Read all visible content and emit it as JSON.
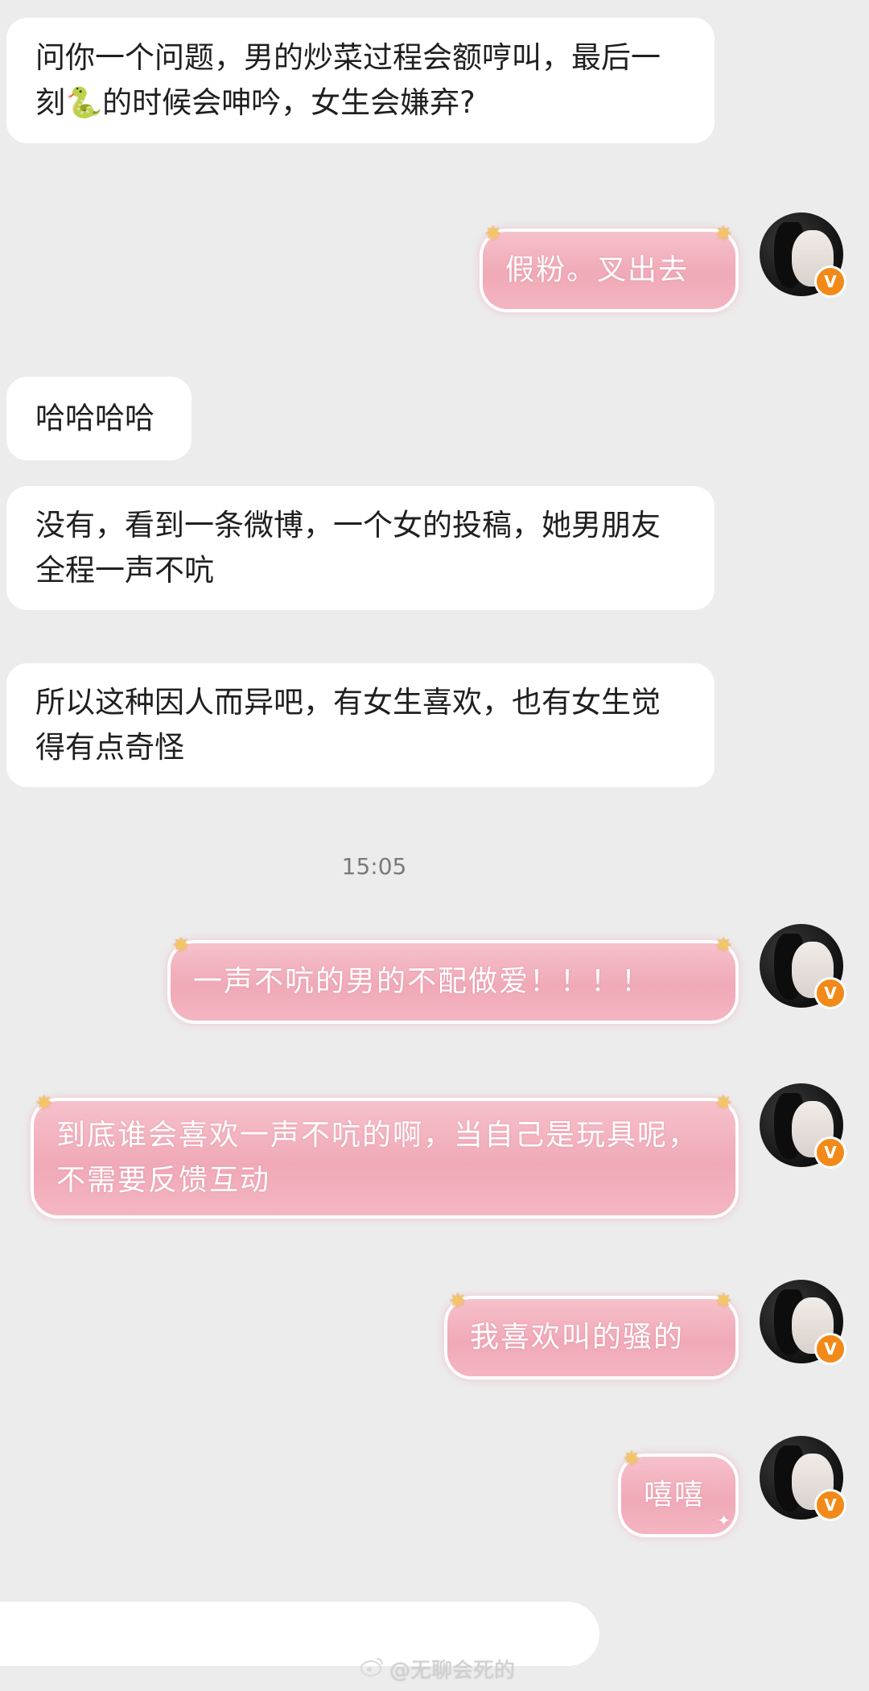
{
  "messages": {
    "m1": "问你一个问题，男的炒菜过程会额哼叫，最后一刻🐍的时候会呻吟，女生会嫌弃?",
    "m2": "假粉。叉出去",
    "m3": "哈哈哈哈",
    "m4": "没有，看到一条微博，一个女的投稿，她男朋友全程一声不吭",
    "m5": "所以这种因人而异吧，有女生喜欢，也有女生觉得有点奇怪",
    "m6": "一声不吭的男的不配做爱！！！！",
    "m7": "到底谁会喜欢一声不吭的啊，当自己是玩具呢，不需要反馈互动",
    "m8": "我喜欢叫的骚的",
    "m9": "嘻嘻"
  },
  "timestamp": "15:05",
  "verified_badge": "V",
  "watermark": "@无聊会死的",
  "colors": {
    "background": "#ececec",
    "bubble_left": "#ffffff",
    "bubble_right": "#f0a9b7",
    "badge": "#f28a1a"
  },
  "icons": {
    "avatar": "avatar-photo",
    "badge": "verified-badge-icon",
    "watermark": "weibo-logo-icon"
  }
}
